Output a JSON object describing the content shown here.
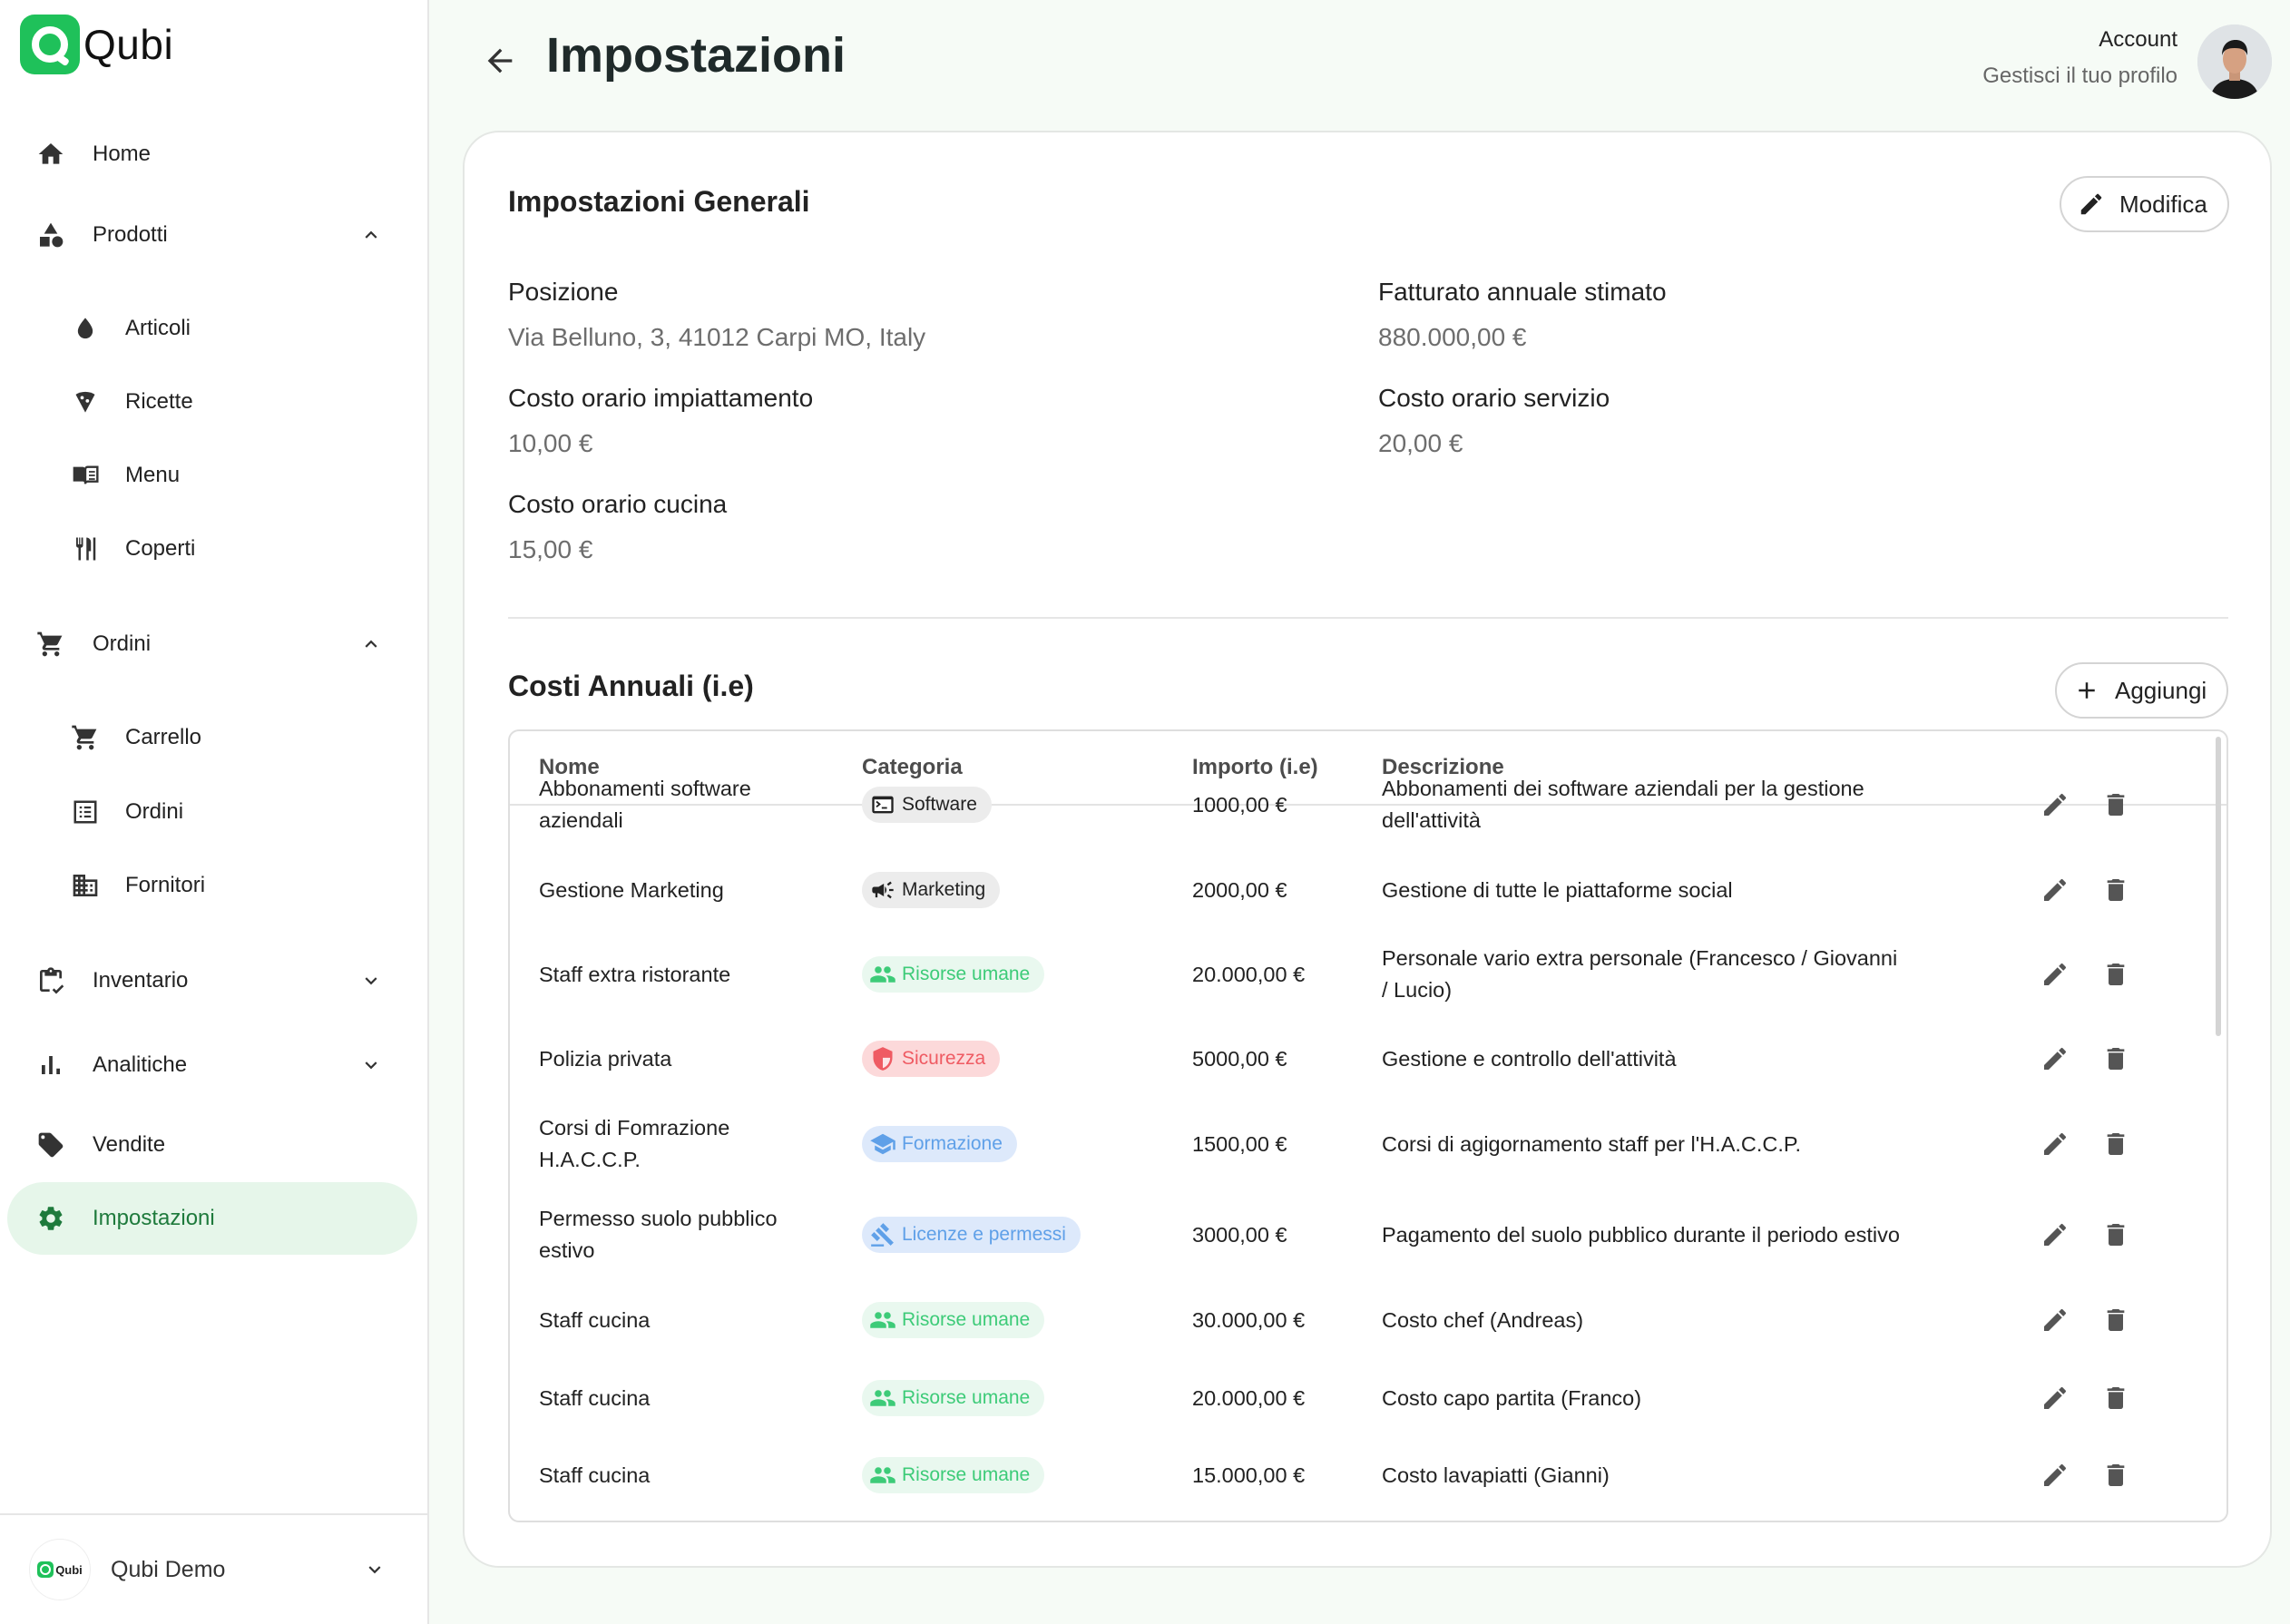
{
  "app": {
    "name": "Qubi"
  },
  "sidebar": {
    "items": [
      {
        "label": "Home",
        "icon": "home-icon"
      },
      {
        "label": "Prodotti",
        "icon": "shapes-icon",
        "expanded": true
      },
      {
        "label": "Articoli",
        "icon": "drop-icon"
      },
      {
        "label": "Ricette",
        "icon": "pizza-icon"
      },
      {
        "label": "Menu",
        "icon": "menu-book-icon"
      },
      {
        "label": "Coperti",
        "icon": "cutlery-icon"
      },
      {
        "label": "Ordini",
        "icon": "cart-icon",
        "expanded": true
      },
      {
        "label": "Carrello",
        "icon": "cart-icon"
      },
      {
        "label": "Ordini",
        "icon": "list-icon"
      },
      {
        "label": "Fornitori",
        "icon": "building-icon"
      },
      {
        "label": "Inventario",
        "icon": "clipboard-check-icon",
        "expanded": false
      },
      {
        "label": "Analitiche",
        "icon": "bar-chart-icon",
        "expanded": false
      },
      {
        "label": "Vendite",
        "icon": "tag-icon"
      },
      {
        "label": "Impostazioni",
        "icon": "gear-icon",
        "active": true
      }
    ],
    "workspace": {
      "logo": "Qubi",
      "name": "Qubi Demo"
    }
  },
  "header": {
    "title": "Impostazioni",
    "account_title": "Account",
    "account_subtitle": "Gestisci il tuo profilo"
  },
  "general": {
    "title": "Impostazioni Generali",
    "edit_label": "Modifica",
    "fields": [
      {
        "label": "Posizione",
        "value": "Via Belluno, 3, 41012 Carpi MO, Italy"
      },
      {
        "label": "Fatturato annuale stimato",
        "value": "880.000,00 €"
      },
      {
        "label": "Costo orario impiattamento",
        "value": "10,00 €"
      },
      {
        "label": "Costo orario servizio",
        "value": "20,00 €"
      },
      {
        "label": "Costo orario cucina",
        "value": "15,00 €"
      }
    ]
  },
  "costs": {
    "title": "Costi Annuali (i.e)",
    "add_label": "Aggiungi",
    "columns": [
      "Nome",
      "Categoria",
      "Importo (i.e)",
      "Descrizione"
    ],
    "rows": [
      {
        "name_l1": "Abbonamenti software",
        "name_l2": "aziendali",
        "category": "Software",
        "cat": "software",
        "amount": "1000,00 €",
        "desc_l1": "Abbonamenti dei software aziendali per la gestione",
        "desc_l2": "dell'attività"
      },
      {
        "name_l1": "Gestione Marketing",
        "name_l2": "",
        "category": "Marketing",
        "cat": "marketing",
        "amount": "2000,00 €",
        "desc_l1": "Gestione di tutte le piattaforme social",
        "desc_l2": ""
      },
      {
        "name_l1": "Staff extra ristorante",
        "name_l2": "",
        "category": "Risorse umane",
        "cat": "hr",
        "amount": "20.000,00 €",
        "desc_l1": "Personale vario extra personale (Francesco / Giovanni",
        "desc_l2": "/ Lucio)"
      },
      {
        "name_l1": "Polizia privata",
        "name_l2": "",
        "category": "Sicurezza",
        "cat": "security",
        "amount": "5000,00 €",
        "desc_l1": "Gestione e controllo dell'attività",
        "desc_l2": ""
      },
      {
        "name_l1": "Corsi di Fomrazione",
        "name_l2": "H.A.C.C.P.",
        "category": "Formazione",
        "cat": "training",
        "amount": "1500,00 €",
        "desc_l1": "Corsi di agigornamento staff per l'H.A.C.C.P.",
        "desc_l2": ""
      },
      {
        "name_l1": "Permesso suolo pubblico",
        "name_l2": "estivo",
        "category": "Licenze e permessi",
        "cat": "license",
        "amount": "3000,00 €",
        "desc_l1": "Pagamento del suolo pubblico durante il periodo estivo",
        "desc_l2": ""
      },
      {
        "name_l1": "Staff cucina",
        "name_l2": "",
        "category": "Risorse umane",
        "cat": "hr",
        "amount": "30.000,00 €",
        "desc_l1": "Costo chef (Andreas)",
        "desc_l2": ""
      },
      {
        "name_l1": "Staff cucina",
        "name_l2": "",
        "category": "Risorse umane",
        "cat": "hr",
        "amount": "20.000,00 €",
        "desc_l1": "Costo capo partita (Franco)",
        "desc_l2": ""
      },
      {
        "name_l1": "Staff cucina",
        "name_l2": "",
        "category": "Risorse umane",
        "cat": "hr",
        "amount": "15.000,00 €",
        "desc_l1": "Costo lavapiatti (Gianni)",
        "desc_l2": ""
      }
    ]
  },
  "colors": {
    "brand": "#1fc15a",
    "active_bg": "#e6f6ea",
    "active_text": "#1e7a3c"
  }
}
